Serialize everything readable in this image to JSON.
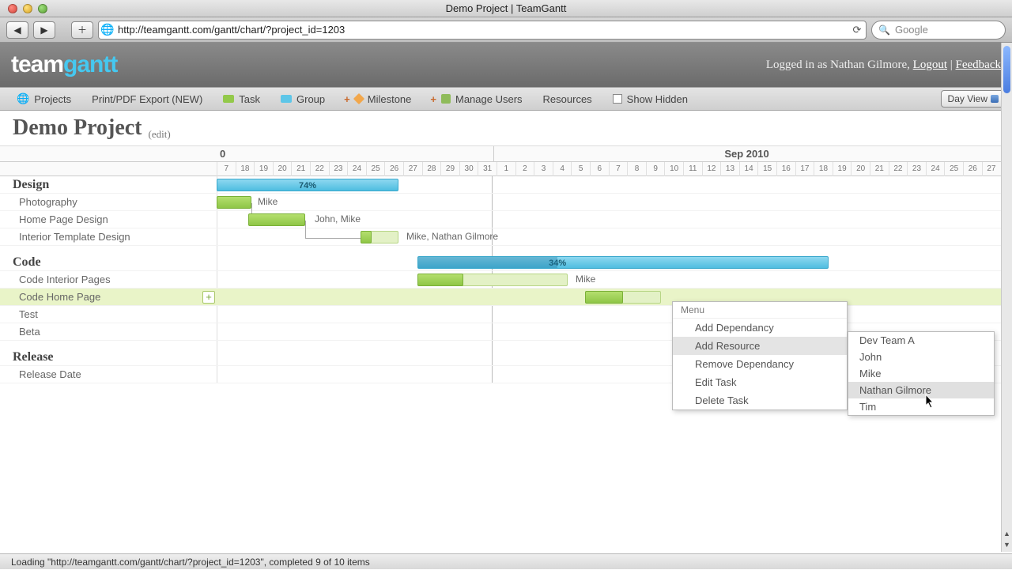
{
  "window": {
    "title": "Demo Project | TeamGantt"
  },
  "browser": {
    "url": "http://teamgantt.com/gantt/chart/?project_id=1203",
    "search_placeholder": "Google"
  },
  "logo": {
    "part1": "team",
    "part2": "gantt"
  },
  "user": {
    "prefix": "Logged in as ",
    "name": "Nathan Gilmore",
    "logout": "Logout",
    "sep": " | ",
    "feedback": "Feedback"
  },
  "toolbar": {
    "projects": "Projects",
    "print": "Print/PDF Export (NEW)",
    "task": "Task",
    "group": "Group",
    "milestone": "Milestone",
    "manage_users": "Manage Users",
    "resources": "Resources",
    "show_hidden": "Show Hidden",
    "view": "Day View"
  },
  "project": {
    "title": "Demo Project",
    "edit": "(edit)"
  },
  "timeline": {
    "month_part": "0",
    "month_full": "Sep 2010",
    "days": [
      "7",
      "18",
      "19",
      "20",
      "21",
      "22",
      "23",
      "24",
      "25",
      "26",
      "27",
      "28",
      "29",
      "30",
      "31",
      "1",
      "2",
      "3",
      "4",
      "5",
      "6",
      "7",
      "8",
      "9",
      "10",
      "11",
      "12",
      "13",
      "14",
      "15",
      "16",
      "17",
      "18",
      "19",
      "20",
      "21",
      "22",
      "23",
      "24",
      "25",
      "26",
      "27"
    ]
  },
  "rows": {
    "design": {
      "label": "Design",
      "pct": "74%"
    },
    "photography": {
      "label": "Photography",
      "res": "Mike"
    },
    "homepage": {
      "label": "Home Page Design",
      "res": "John, Mike"
    },
    "interior_tpl": {
      "label": "Interior Template Design",
      "res": "Mike, Nathan Gilmore"
    },
    "code": {
      "label": "Code",
      "pct": "34%"
    },
    "code_interior": {
      "label": "Code Interior Pages",
      "res": "Mike"
    },
    "code_home": {
      "label": "Code Home Page"
    },
    "test": {
      "label": "Test"
    },
    "beta": {
      "label": "Beta"
    },
    "release": {
      "label": "Release"
    },
    "release_date": {
      "label": "Release Date"
    }
  },
  "context_menu": {
    "header": "Menu",
    "items": [
      "Add Dependancy",
      "Add Resource",
      "Remove Dependancy",
      "Edit Task",
      "Delete Task"
    ]
  },
  "resource_submenu": [
    "Dev Team A",
    "John",
    "Mike",
    "Nathan Gilmore",
    "Tim"
  ],
  "status": "Loading \"http://teamgantt.com/gantt/chart/?project_id=1203\", completed 9 of 10 items"
}
